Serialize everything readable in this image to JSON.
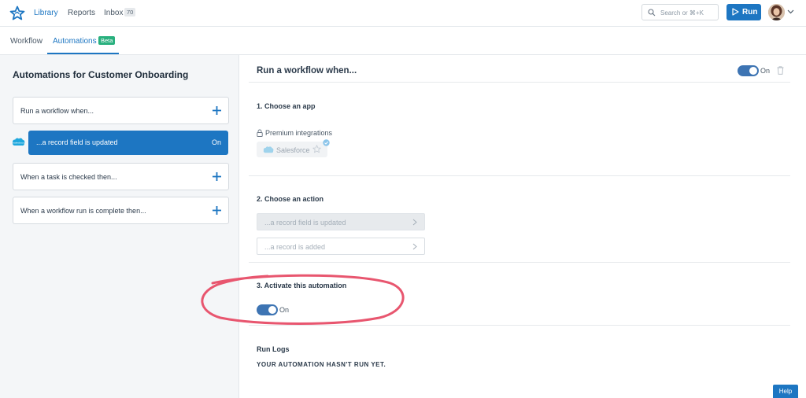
{
  "header": {
    "nav": {
      "library": "Library",
      "reports": "Reports",
      "inbox": "Inbox",
      "inbox_count": "70"
    },
    "search": {
      "placeholder": "Search or ⌘+K"
    },
    "run_label": "Run"
  },
  "subnav": {
    "workflow": "Workflow",
    "automations": "Automations",
    "beta": "Beta"
  },
  "sidebar": {
    "title": "Automations for Customer Onboarding",
    "cards": [
      {
        "label": "Run a workflow when..."
      },
      {
        "label": "...a record field is updated",
        "status": "On"
      },
      {
        "label": "When a task is checked then..."
      },
      {
        "label": "When a workflow run is complete then..."
      }
    ]
  },
  "main": {
    "title": "Run a workflow when...",
    "header_toggle_label": "On",
    "section1": {
      "title": "1. Choose an app",
      "premium_label": "Premium integrations",
      "app_name": "Salesforce"
    },
    "section2": {
      "title": "2. Choose an action",
      "actions": [
        "...a record field is updated",
        "...a record is added"
      ]
    },
    "section3": {
      "title": "3. Activate this automation",
      "toggle_label": "On"
    },
    "run_logs": {
      "title": "Run Logs",
      "empty": "YOUR AUTOMATION HASN'T RUN YET."
    }
  },
  "help_label": "Help",
  "colors": {
    "accent": "#1d76c2",
    "toggle": "#3d74b3",
    "beta": "#29b07e",
    "annotation": "#e8566f"
  },
  "icons": [
    "star-logo-icon",
    "search-icon",
    "play-icon",
    "chevron-down-icon",
    "plus-icon",
    "salesforce-icon",
    "trash-icon",
    "lock-icon",
    "star-icon",
    "check-badge-icon",
    "chevron-right-icon"
  ]
}
